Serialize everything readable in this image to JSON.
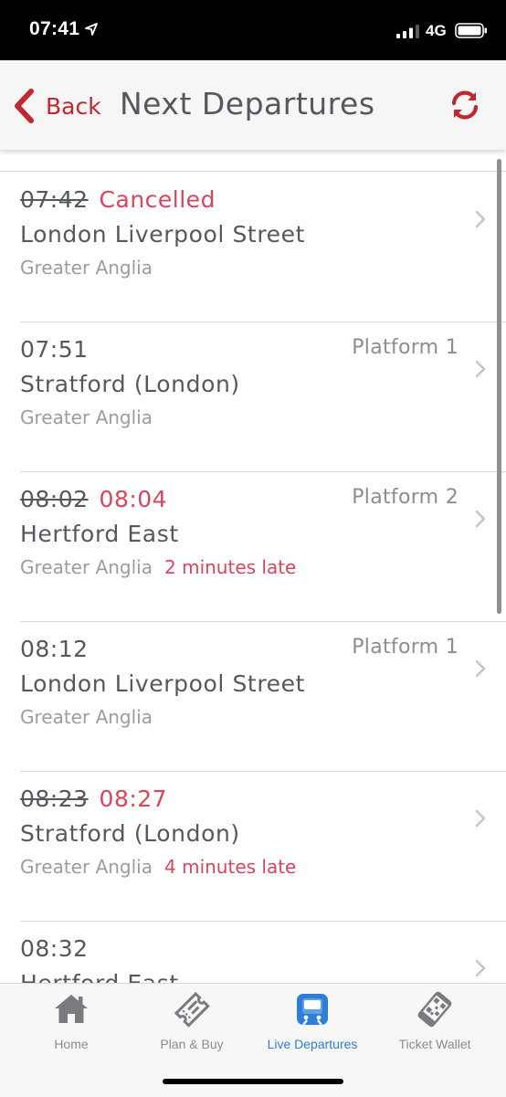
{
  "status_bar": {
    "time": "07:41",
    "network": "4G"
  },
  "header": {
    "back_label": "Back",
    "title": "Next Departures"
  },
  "departures": [
    {
      "scheduled": "07:42",
      "scheduled_struck": true,
      "expected": "",
      "status": "Cancelled",
      "platform": "",
      "destination": "London Liverpool Street",
      "operator": "Greater Anglia",
      "delay": ""
    },
    {
      "scheduled": "07:51",
      "scheduled_struck": false,
      "expected": "",
      "status": "",
      "platform": "Platform 1",
      "destination": "Stratford (London)",
      "operator": "Greater Anglia",
      "delay": ""
    },
    {
      "scheduled": "08:02",
      "scheduled_struck": true,
      "expected": "08:04",
      "status": "",
      "platform": "Platform 2",
      "destination": "Hertford East",
      "operator": "Greater Anglia",
      "delay": "2 minutes late"
    },
    {
      "scheduled": "08:12",
      "scheduled_struck": false,
      "expected": "",
      "status": "",
      "platform": "Platform 1",
      "destination": "London Liverpool Street",
      "operator": "Greater Anglia",
      "delay": ""
    },
    {
      "scheduled": "08:23",
      "scheduled_struck": true,
      "expected": "08:27",
      "status": "",
      "platform": "",
      "destination": "Stratford (London)",
      "operator": "Greater Anglia",
      "delay": "4 minutes late"
    },
    {
      "scheduled": "08:32",
      "scheduled_struck": false,
      "expected": "",
      "status": "",
      "platform": "",
      "destination": "Hertford East",
      "operator": "",
      "delay": ""
    }
  ],
  "tabs": [
    {
      "label": "Home",
      "icon": "home-icon",
      "active": false
    },
    {
      "label": "Plan & Buy",
      "icon": "ticket-icon",
      "active": false
    },
    {
      "label": "Live Departures",
      "icon": "train-icon",
      "active": true
    },
    {
      "label": "Ticket Wallet",
      "icon": "phone-qr-icon",
      "active": false
    }
  ],
  "colors": {
    "accent": "#c2272f",
    "late": "#d9455d",
    "active_tab": "#2c7fd8"
  }
}
